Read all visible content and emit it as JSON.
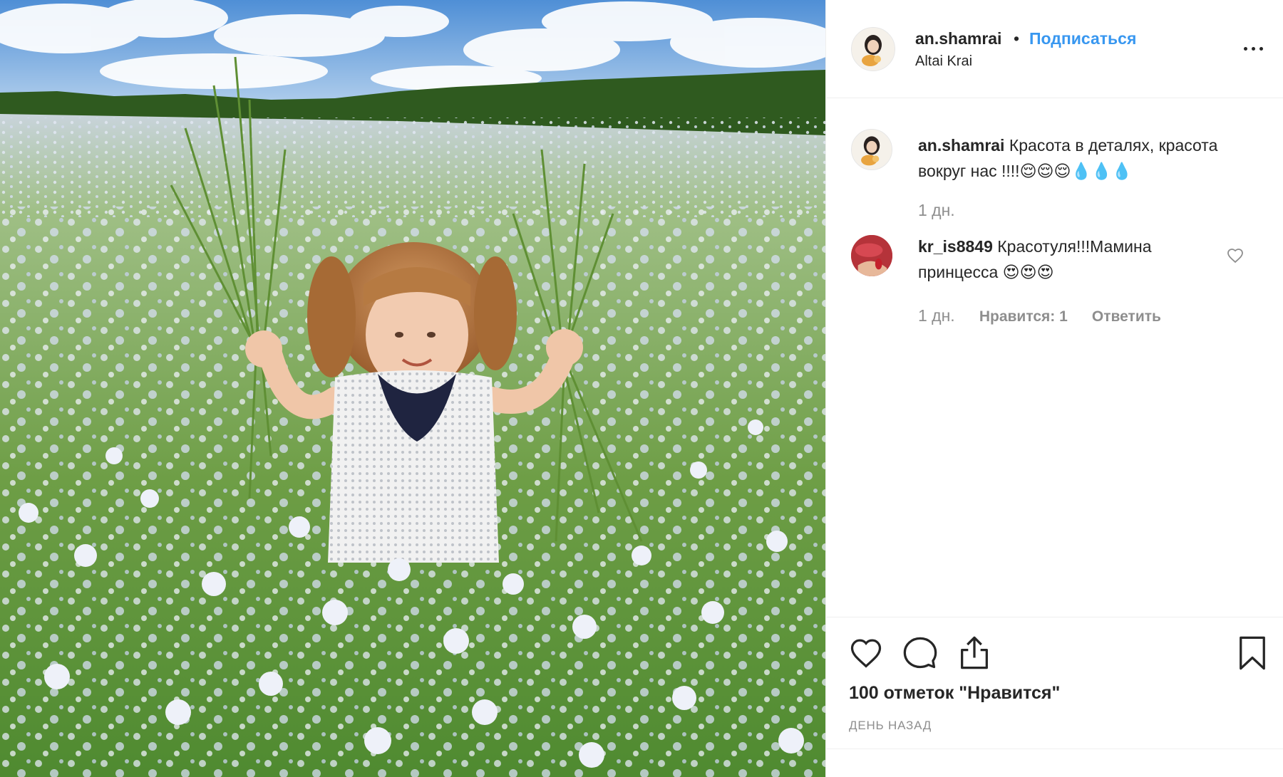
{
  "post": {
    "username": "an.shamrai",
    "separator": "•",
    "follow_label": "Подписаться",
    "location": "Altai Krai"
  },
  "caption": {
    "username": "an.shamrai",
    "text": "Красота в деталях, красота вокруг нас !!!!😌😌😌💧💧💧",
    "time": "1 дн."
  },
  "comments": [
    {
      "username": "kr_is8849",
      "text": "Красотуля!!!Мамина принцесса 😍😍😍",
      "time": "1 дн.",
      "likes_label": "Нравится: 1",
      "reply_label": "Ответить"
    }
  ],
  "actions": {
    "like_icon": "heart-icon",
    "comment_icon": "comment-icon",
    "share_icon": "share-icon",
    "save_icon": "bookmark-icon"
  },
  "likes_count": "100 отметок \"Нравится\"",
  "post_date": "ДЕНЬ НАЗАД",
  "colors": {
    "link": "#3897f0",
    "text": "#262626",
    "muted": "#8e8e8e",
    "border": "#efefef"
  }
}
